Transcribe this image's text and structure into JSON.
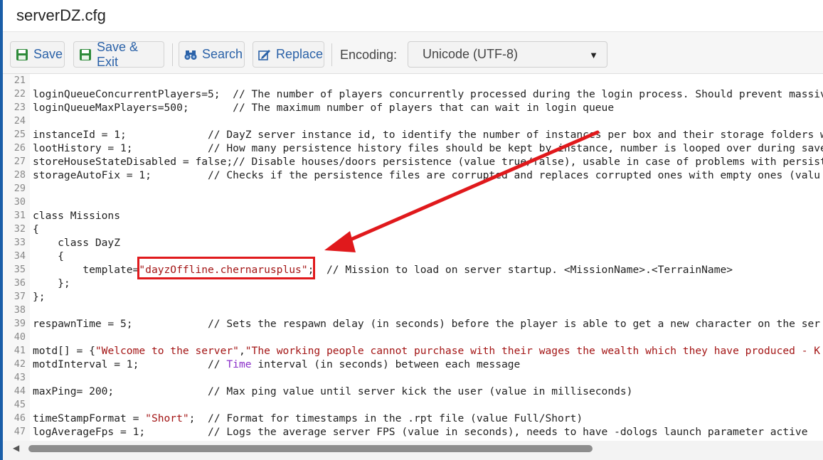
{
  "window": {
    "title": "serverDZ.cfg"
  },
  "toolbar": {
    "save_label": "Save",
    "save_exit_label": "Save & Exit",
    "search_label": "Search",
    "replace_label": "Replace",
    "encoding_label": "Encoding:",
    "encoding_value": "Unicode (UTF-8)"
  },
  "editor": {
    "lines": [
      {
        "n": "21",
        "text": ""
      },
      {
        "n": "22",
        "text": "loginQueueConcurrentPlayers=5;  // The number of players concurrently processed during the login process. Should prevent massive"
      },
      {
        "n": "23",
        "text": "loginQueueMaxPlayers=500;       // The maximum number of players that can wait in login queue"
      },
      {
        "n": "24",
        "text": ""
      },
      {
        "n": "25",
        "text": "instanceId = 1;             // DayZ server instance id, to identify the number of instances per box and their storage folders wi"
      },
      {
        "n": "26",
        "text": "lootHistory = 1;            // How many persistence history files should be kept by instance, number is looped over during save"
      },
      {
        "n": "27",
        "text": "storeHouseStateDisabled = false;// Disable houses/doors persistence (value true/false), usable in case of problems with persist"
      },
      {
        "n": "28",
        "text": "storageAutoFix = 1;         // Checks if the persistence files are corrupted and replaces corrupted ones with empty ones (valu"
      },
      {
        "n": "29",
        "text": ""
      },
      {
        "n": "30",
        "text": ""
      },
      {
        "n": "31",
        "text": "class Missions"
      },
      {
        "n": "32",
        "text": "{"
      },
      {
        "n": "33",
        "text": "    class DayZ"
      },
      {
        "n": "34",
        "text": "    {"
      },
      {
        "n": "35",
        "pre": "        template=",
        "str": "\"dayzOffline.chernarusplus\"",
        "post": ";  // Mission to load on server startup. <MissionName>.<TerrainName>"
      },
      {
        "n": "36",
        "text": "    };"
      },
      {
        "n": "37",
        "text": "};"
      },
      {
        "n": "38",
        "text": ""
      },
      {
        "n": "39",
        "text": "respawnTime = 5;            // Sets the respawn delay (in seconds) before the player is able to get a new character on the ser"
      },
      {
        "n": "40",
        "text": ""
      },
      {
        "n": "41",
        "pre": "motd[] = {",
        "str": "\"Welcome to the server\"",
        "post": ",",
        "str2": "\"The working people cannot purchase with their wages the wealth which they have produced - K"
      },
      {
        "n": "42",
        "pre": "motdInterval = 1;           // ",
        "kw": "Time",
        "post": " interval (in seconds) between each message"
      },
      {
        "n": "43",
        "text": ""
      },
      {
        "n": "44",
        "text": "maxPing= 200;               // Max ping value until server kick the user (value in milliseconds)"
      },
      {
        "n": "45",
        "text": ""
      },
      {
        "n": "46",
        "pre": "timeStampFormat = ",
        "str": "\"Short\"",
        "post": ";  // Format for timestamps in the .rpt file (value Full/Short)"
      },
      {
        "n": "47",
        "text": "logAverageFps = 1;          // Logs the average server FPS (value in seconds), needs to have -dologs launch parameter active"
      },
      {
        "n": "48",
        "text": "logMemory = 1;              // Logs the server memory usage (value in seconds), needs to have the -dologs launch parameter act"
      }
    ]
  },
  "colors": {
    "annotation": "#e0191c",
    "string": "#a31515",
    "keyword": "#8b2fc9",
    "button_text": "#2b62a8"
  }
}
